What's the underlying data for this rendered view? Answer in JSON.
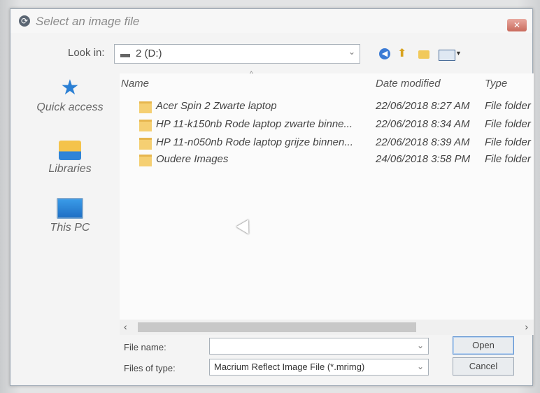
{
  "window": {
    "title": "Select an image file",
    "close_glyph": "✕"
  },
  "toolbar": {
    "lookin_label": "Look in:",
    "lookin_value": "2 (D:)",
    "icons": [
      "back-icon",
      "up-folder-icon",
      "new-folder-icon",
      "view-menu-icon"
    ]
  },
  "places": [
    {
      "label": "Quick access",
      "icon": "star-icon"
    },
    {
      "label": "Libraries",
      "icon": "libraries-icon"
    },
    {
      "label": "This PC",
      "icon": "pc-icon"
    }
  ],
  "columns": {
    "name": "Name",
    "date": "Date modified",
    "type": "Type"
  },
  "rows": [
    {
      "name": "Acer Spin 2 Zwarte laptop",
      "date": "22/06/2018 8:27 AM",
      "type": "File folder"
    },
    {
      "name": "HP 11-k150nb Rode laptop zwarte binne...",
      "date": "22/06/2018 8:34 AM",
      "type": "File folder"
    },
    {
      "name": "HP 11-n050nb Rode laptop grijze binnen...",
      "date": "22/06/2018 8:39 AM",
      "type": "File folder"
    },
    {
      "name": "Oudere Images",
      "date": "24/06/2018 3:58 PM",
      "type": "File folder"
    }
  ],
  "footer": {
    "filename_label": "File name:",
    "filename_value": "",
    "filetype_label": "Files of type:",
    "filetype_value": "Macrium Reflect Image File (*.mrimg)",
    "open_label": "Open",
    "cancel_label": "Cancel"
  },
  "colors": {
    "accent": "#3b7bd5",
    "folder": "#f5cf72"
  }
}
